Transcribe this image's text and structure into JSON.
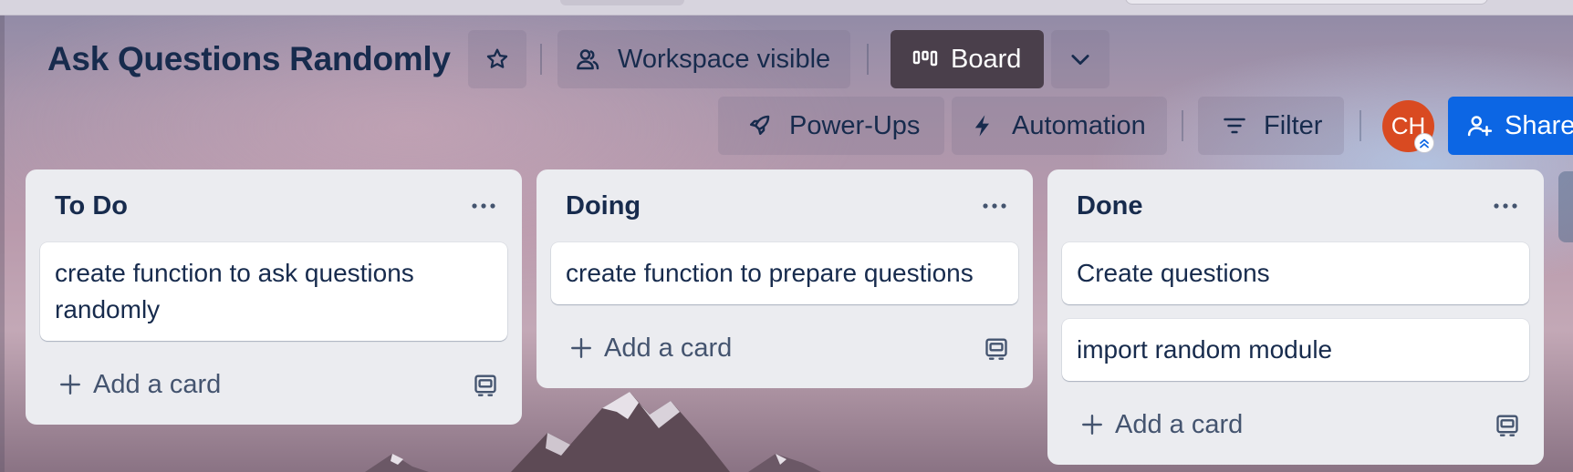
{
  "board": {
    "title": "Ask Questions Randomly",
    "visibility_label": "Workspace visible",
    "view_label": "Board",
    "powerups_label": "Power-Ups",
    "automation_label": "Automation",
    "filter_label": "Filter",
    "share_label": "Share",
    "avatar_initials": "CH"
  },
  "lists": [
    {
      "title": "To Do",
      "cards": [
        "create function to ask questions randomly"
      ],
      "add_label": "Add a card"
    },
    {
      "title": "Doing",
      "cards": [
        "create function to prepare questions"
      ],
      "add_label": "Add a card"
    },
    {
      "title": "Done",
      "cards": [
        "Create questions",
        "import random module"
      ],
      "add_label": "Add a card"
    }
  ],
  "colors": {
    "title_text": "#172b4d",
    "share_button": "#0c66e4",
    "board_button": "#4a3f4b",
    "avatar": "#d94a21",
    "list_bg": "#ebecf0"
  },
  "icons": {
    "star": "star-icon",
    "visibility": "people-icon",
    "board": "board-columns-icon",
    "chevron": "chevron-down-icon",
    "powerups": "rocket-icon",
    "automation": "lightning-icon",
    "filter": "filter-icon",
    "share": "add-person-icon",
    "list_menu": "ellipsis-icon",
    "add": "plus-icon",
    "template": "card-template-icon"
  }
}
